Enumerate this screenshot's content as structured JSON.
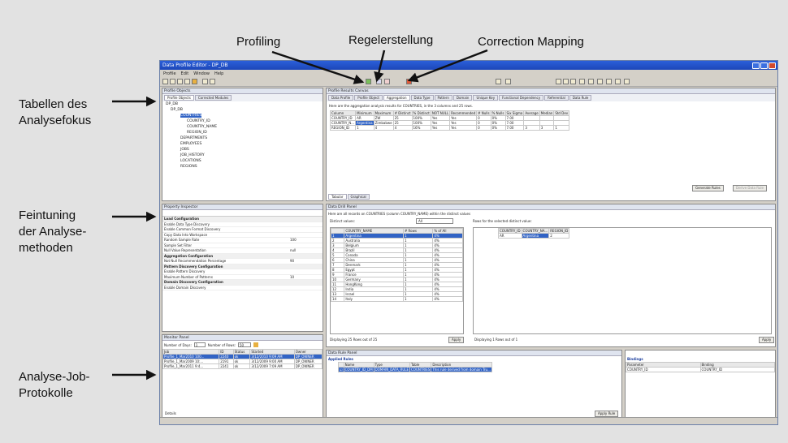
{
  "callouts": {
    "profiling": "Profiling",
    "regelerstellung": "Regelerstellung",
    "correction": "Correction Mapping",
    "tabellen_1": "Tabellen des",
    "tabellen_2": "Analysefokus",
    "feintuning_1": "Feintuning",
    "feintuning_2": "der Analyse-",
    "feintuning_3": "methoden",
    "job_1": "Analyse-Job-",
    "job_2": "Protokolle"
  },
  "app": {
    "title": "Data Profile Editor - DP_DB",
    "menu": [
      "Profile",
      "Edit",
      "Window",
      "Help"
    ]
  },
  "profile_objects": {
    "title": "Profile Objects",
    "tabs": [
      "Profile Objects",
      "Corrected Modules"
    ],
    "tree": [
      "DP_DB",
      "DP_DB",
      "COUNTRY_ID",
      "COUNTRY_NAME",
      "COUNTRY_ID",
      "COUNTRY_NAME",
      "REGION_ID",
      "DEPARTMENTS",
      "EMPLOYEES",
      "JOBS",
      "JOB_HISTORY",
      "LOCATIONS",
      "REGIONS"
    ]
  },
  "results": {
    "title": "Profile Results Canvas",
    "tabs": [
      "Data Profile",
      "Profile Object",
      "Aggregation",
      "Data Type",
      "Pattern",
      "Domain",
      "Unique Key",
      "Functional Dependency",
      "Referential",
      "Data Rule"
    ],
    "hint": "Here are the aggregation analysis results for COUNTRIES, in the 3 columns and 25 rows.",
    "columns": [
      "Column",
      "Minimum",
      "Maximum",
      "# Distinct",
      "% Distinct",
      "NOT NULL",
      "Recommended",
      "# Nulls",
      "% Nulls",
      "Six Sigma",
      "Average",
      "Median",
      "Std Dev"
    ],
    "rows": [
      [
        "COUNTRY_ID",
        "AR",
        "ZW",
        "25",
        "100%",
        "Yes",
        "Yes",
        "0",
        "0%",
        "7.00",
        "",
        "",
        ""
      ],
      [
        "COUNTRY_N...",
        "Argentina",
        "Zimbabwe",
        "25",
        "100%",
        "Yes",
        "Yes",
        "0",
        "0%",
        "7.00",
        "",
        "",
        ""
      ],
      [
        "REGION_ID",
        "1",
        "4",
        "4",
        "16%",
        "Yes",
        "Yes",
        "0",
        "0%",
        "7.00",
        "3",
        "3",
        "1"
      ]
    ],
    "bottom_tabs": [
      "Tabular",
      "Graphical"
    ],
    "buttons": [
      "Generate Rules",
      "Derive Data Rule"
    ]
  },
  "property_inspector": {
    "title": "Property Inspector",
    "rows": [
      {
        "label": "Load Configuration",
        "value": "",
        "hdr": true
      },
      {
        "label": "Enable Data Type Discovery",
        "value": ""
      },
      {
        "label": "Enable Common Format Discovery",
        "value": ""
      },
      {
        "label": "Copy Data Into Workspace",
        "value": ""
      },
      {
        "label": "Random Sample Rate",
        "value": "100"
      },
      {
        "label": "Sample Set Filter",
        "value": ""
      },
      {
        "label": "Null Value Representation",
        "value": "null"
      },
      {
        "label": "Aggregation Configuration",
        "value": "",
        "hdr": true
      },
      {
        "label": "Not Null Recommendation Percentage",
        "value": "90"
      },
      {
        "label": "Pattern Discovery Configuration",
        "value": "",
        "hdr": true
      },
      {
        "label": "Enable Pattern Discovery",
        "value": ""
      },
      {
        "label": "Maximum Number of Patterns",
        "value": "10"
      },
      {
        "label": "Domain Discovery Configuration",
        "value": "",
        "hdr": true
      },
      {
        "label": "Enable Domain Discovery",
        "value": ""
      }
    ]
  },
  "data_drill": {
    "title": "Data Drill Panel",
    "hint": "Here are all records on COUNTRIES (column COUNTRY_NAME) within the distinct values",
    "distinct_label": "Distinct values:",
    "distinct_value": "All",
    "rows_label": "Rows for the selected distinct value:",
    "dcols": [
      "COUNTRY_NAME",
      "# Rows",
      "% of All"
    ],
    "drows": [
      [
        "Argentina",
        "1",
        "4%"
      ],
      [
        "Australia",
        "1",
        "4%"
      ],
      [
        "Belgium",
        "1",
        "4%"
      ],
      [
        "Brazil",
        "1",
        "4%"
      ],
      [
        "Canada",
        "1",
        "4%"
      ],
      [
        "China",
        "1",
        "4%"
      ],
      [
        "Denmark",
        "1",
        "4%"
      ],
      [
        "Egypt",
        "1",
        "4%"
      ],
      [
        "France",
        "1",
        "4%"
      ],
      [
        "Germany",
        "1",
        "4%"
      ],
      [
        "HongKong",
        "1",
        "4%"
      ],
      [
        "India",
        "1",
        "4%"
      ],
      [
        "Israel",
        "1",
        "4%"
      ],
      [
        "Italy",
        "1",
        "4%"
      ]
    ],
    "rcols": [
      "COUNTRY_ID",
      "COUNTRY_NA...",
      "REGION_ID"
    ],
    "rrow": [
      "AR",
      "Argentina",
      "2"
    ],
    "left_status": "Displaying 25 Rows out of 25",
    "right_status": "Displaying 1 Rows out of 1",
    "btn": "Apply"
  },
  "monitor": {
    "title": "Monitor Panel",
    "num_label": "Number of Days:",
    "num_value": "1",
    "rows_label": "Number of Rows:",
    "rows_value": "50",
    "cols": [
      "Job",
      "ID",
      "Status",
      "Started",
      "Owner"
    ],
    "rows": [
      [
        "Profile_1_Mar2010 100...",
        "2240",
        "ok",
        "3/12/2010 9:09 AM",
        "DP_OWNER"
      ],
      [
        "Profile_1_Mar2009 10:...",
        "2191",
        "ok",
        "3/12/2009 9:00 AM",
        "DP_OWNER"
      ],
      [
        "Profile_1_Mar2011 9:4...",
        "2241",
        "ok",
        "3/12/2009 7:09 AM",
        "DP_OWNER"
      ]
    ],
    "footer": "Details"
  },
  "rule_panel": {
    "title": "Data Rule Panel",
    "sub": "Applied Rules",
    "cols": [
      "",
      "Name",
      "Type",
      "Table",
      "Description"
    ],
    "row": [
      "COUNTRY_ID_DM",
      "DOMAIN_DATA_RULE",
      "COUNTRIES",
      "This rule derived from domain Tru..."
    ],
    "btn": "Apply Rule"
  },
  "bindings": {
    "title": "Bindings",
    "cols": [
      "Parameter",
      "Binding"
    ],
    "row": [
      "COUNTRY_ID",
      "COUNTRY_ID"
    ]
  }
}
